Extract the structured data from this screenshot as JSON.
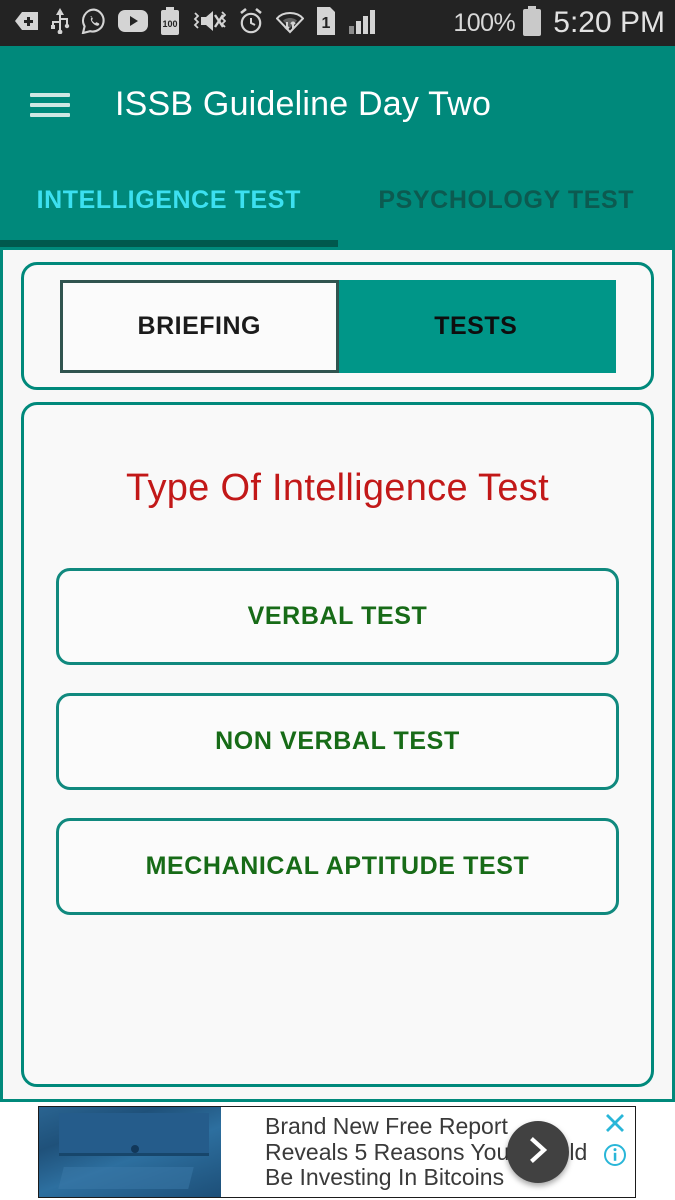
{
  "status_bar": {
    "icons_left": [
      "plus-tag-icon",
      "usb-icon",
      "whatsapp-icon",
      "youtube-icon",
      "battery-saver-100-icon",
      "mute-vibrate-icon",
      "alarm-icon",
      "wifi-data-icon",
      "sim-1-icon",
      "signal-bars-icon"
    ],
    "battery_percent": "100%",
    "battery_icon": "battery-full-icon",
    "time": "5:20 PM"
  },
  "app_bar": {
    "menu_icon": "hamburger-menu-icon",
    "title": "ISSB Guideline Day Two",
    "background_color": "#00897B",
    "title_color": "#ffffff"
  },
  "tabs": {
    "items": [
      {
        "label": "INTELLIGENCE TEST",
        "active": true
      },
      {
        "label": "PSYCHOLOGY TEST",
        "active": false
      }
    ],
    "active_color": "#3ce0f0",
    "inactive_color": "#0c5a50",
    "indicator_color": "#00584d"
  },
  "segmented_control": {
    "options": [
      {
        "label": "BRIEFING",
        "selected": false
      },
      {
        "label": "TESTS",
        "selected": true
      }
    ],
    "selected_background": "#009688"
  },
  "content": {
    "section_title": "Type Of Intelligence Test",
    "section_title_color": "#c21818",
    "test_buttons": [
      {
        "label": "VERBAL TEST"
      },
      {
        "label": "NON VERBAL TEST"
      },
      {
        "label": "MECHANICAL APTITUDE TEST"
      }
    ],
    "button_text_color": "#176b17",
    "button_border_color": "#10897E"
  },
  "ad": {
    "thumbnail": "desktop-computer-photo",
    "lines": [
      "Brand New Free Report",
      "Reveals 5 Reasons You Should",
      "Be Investing In Bitcoins"
    ],
    "cta_icon": "chevron-right-icon",
    "close_icon": "close-x-icon",
    "info_icon": "info-circle-icon",
    "control_color": "#29b6d8"
  }
}
